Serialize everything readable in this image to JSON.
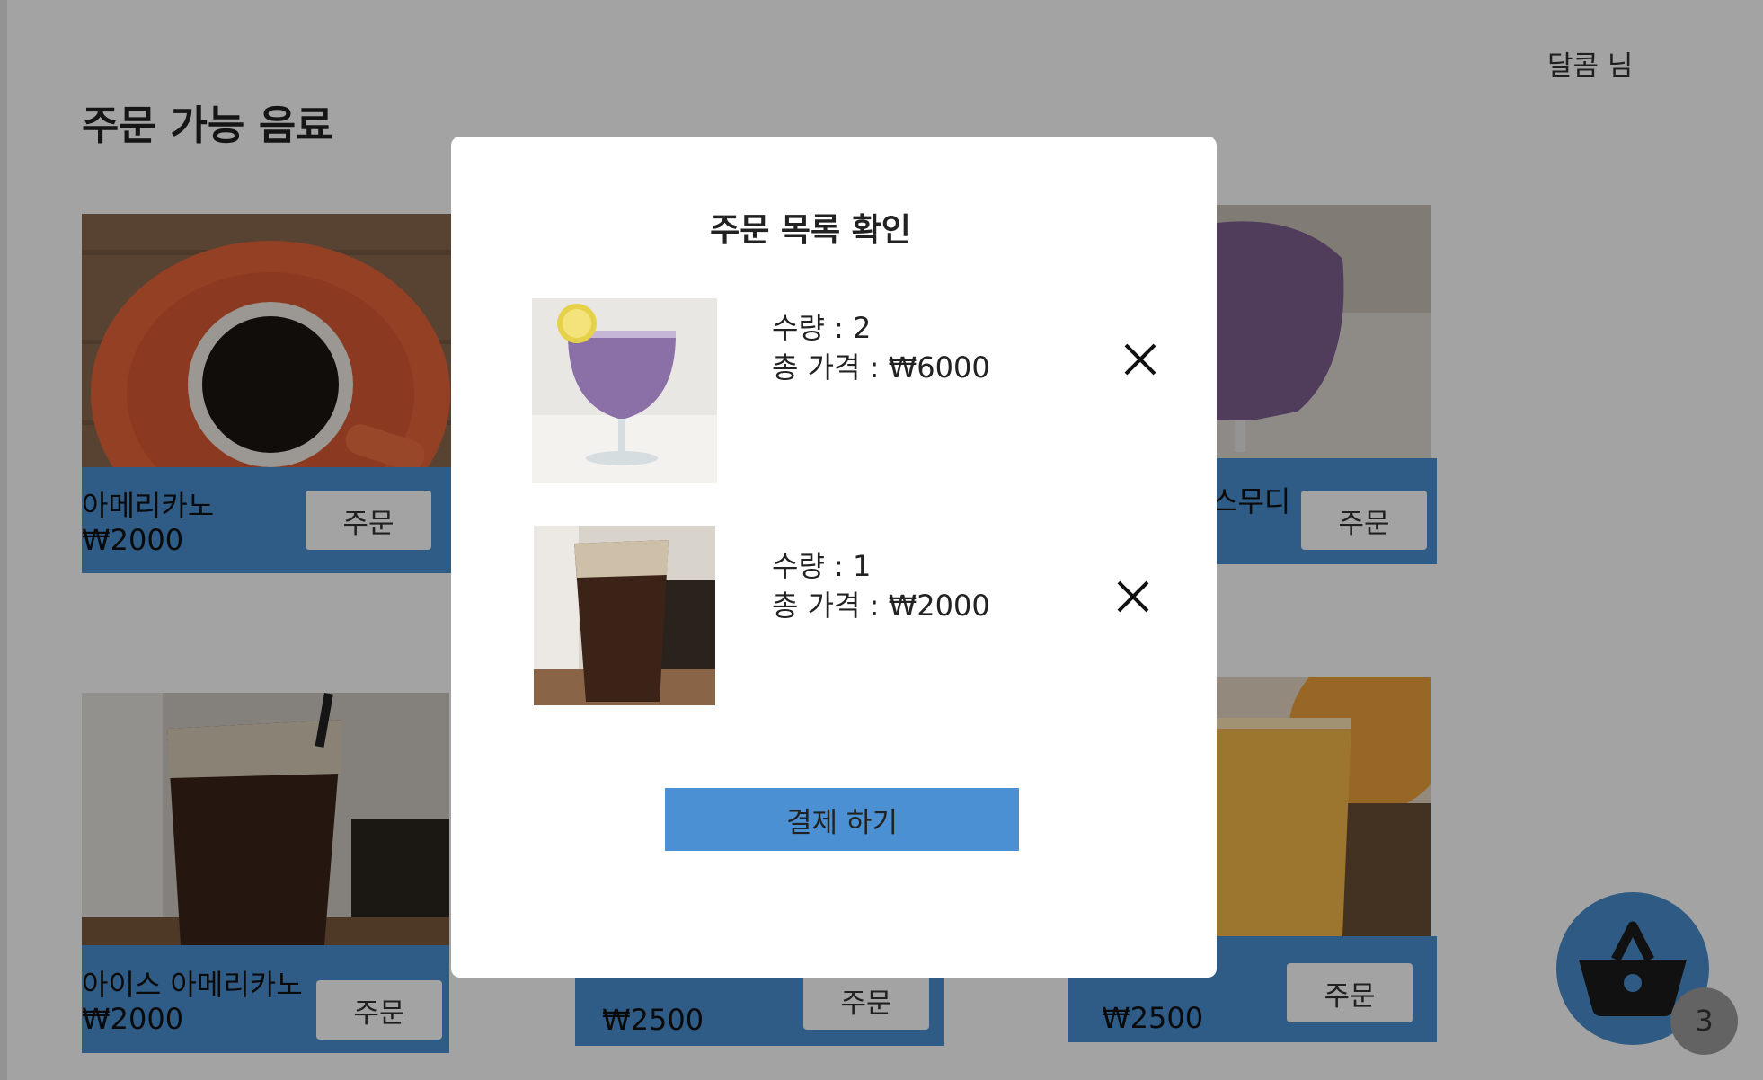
{
  "header": {
    "user_name": "달콤 님",
    "page_title": "주문 가능 음료"
  },
  "menu": [
    {
      "name": "아메리카노",
      "price": "₩2000",
      "order_label": "주문"
    },
    {
      "name": "스무디",
      "price": "",
      "order_label": "주문"
    },
    {
      "name": "아이스 아메리카노",
      "price": "₩2000",
      "order_label": "주문"
    },
    {
      "name": "",
      "price": "₩2500",
      "order_label": "주문"
    },
    {
      "name": "",
      "price": "₩2500",
      "order_label": "주문"
    }
  ],
  "cart": {
    "count": "3"
  },
  "modal": {
    "title": "주문 목록 확인",
    "items": [
      {
        "quantity": "수량 : 2",
        "total": "총 가격 :  ₩6000"
      },
      {
        "quantity": "수량 : 1",
        "total": "총 가격 :  ₩2000"
      }
    ],
    "pay_label": "결제 하기"
  },
  "colors": {
    "accent": "#4a90d2",
    "overlay": "rgba(0,0,0,0.36)",
    "badge": "#9e9e9e"
  }
}
